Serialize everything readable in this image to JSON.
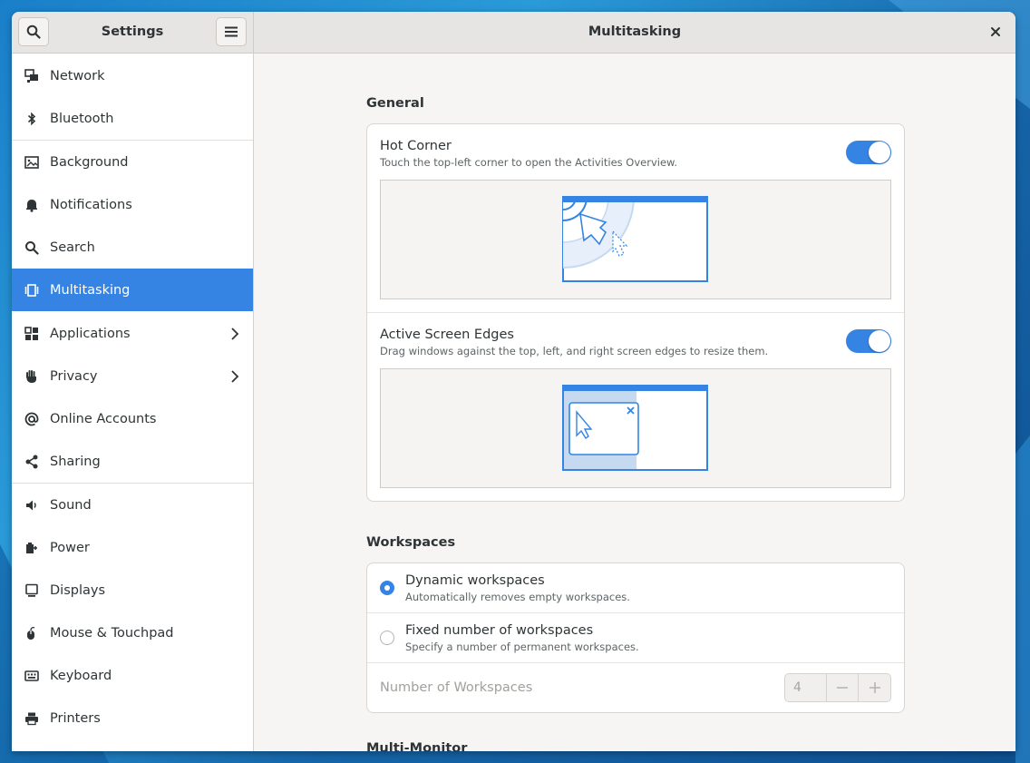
{
  "sidebar": {
    "title": "Settings",
    "items": [
      {
        "label": "Network",
        "icon": "network-icon"
      },
      {
        "label": "Bluetooth",
        "icon": "bluetooth-icon"
      },
      {
        "label": "Background",
        "icon": "background-icon"
      },
      {
        "label": "Notifications",
        "icon": "bell-icon"
      },
      {
        "label": "Search",
        "icon": "search-icon"
      },
      {
        "label": "Multitasking",
        "icon": "multitasking-icon",
        "active": true
      },
      {
        "label": "Applications",
        "icon": "apps-icon",
        "has_submenu": true
      },
      {
        "label": "Privacy",
        "icon": "hand-icon",
        "has_submenu": true
      },
      {
        "label": "Online Accounts",
        "icon": "at-icon"
      },
      {
        "label": "Sharing",
        "icon": "share-icon"
      },
      {
        "label": "Sound",
        "icon": "speaker-icon"
      },
      {
        "label": "Power",
        "icon": "power-icon"
      },
      {
        "label": "Displays",
        "icon": "display-icon"
      },
      {
        "label": "Mouse & Touchpad",
        "icon": "mouse-icon"
      },
      {
        "label": "Keyboard",
        "icon": "keyboard-icon"
      },
      {
        "label": "Printers",
        "icon": "printer-icon"
      }
    ]
  },
  "header": {
    "title": "Multitasking"
  },
  "general": {
    "title": "General",
    "hot_corner": {
      "title": "Hot Corner",
      "subtitle": "Touch the top-left corner to open the Activities Overview.",
      "enabled": true
    },
    "active_edges": {
      "title": "Active Screen Edges",
      "subtitle": "Drag windows against the top, left, and right screen edges to resize them.",
      "enabled": true
    }
  },
  "workspaces": {
    "title": "Workspaces",
    "dynamic": {
      "title": "Dynamic workspaces",
      "subtitle": "Automatically removes empty workspaces.",
      "selected": true
    },
    "fixed": {
      "title": "Fixed number of workspaces",
      "subtitle": "Specify a number of permanent workspaces.",
      "selected": false
    },
    "count": {
      "label": "Number of Workspaces",
      "value": "4"
    }
  },
  "multi_monitor": {
    "title": "Multi-Monitor"
  },
  "colors": {
    "accent": "#3584e4"
  }
}
